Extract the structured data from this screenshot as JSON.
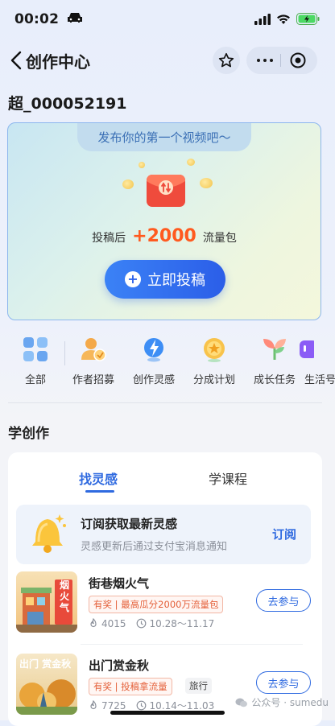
{
  "status_bar": {
    "time": "00:02"
  },
  "nav": {
    "title": "创作中心"
  },
  "account": {
    "name": "超_000052191"
  },
  "promo": {
    "tab_text": "发布你的第一个视频吧～",
    "reward_prefix": "投稿后",
    "reward_amount": "+2000",
    "reward_suffix": "流量包",
    "button_label": "立即投稿"
  },
  "shortcuts": [
    {
      "label": "全部",
      "icon": "grid-icon"
    },
    {
      "label": "作者招募",
      "icon": "recruit-icon"
    },
    {
      "label": "创作灵感",
      "icon": "lightning-icon"
    },
    {
      "label": "分成计划",
      "icon": "medal-icon"
    },
    {
      "label": "成长任务",
      "icon": "sprout-icon"
    },
    {
      "label": "生活号",
      "icon": "life-icon"
    }
  ],
  "learn": {
    "section_title": "学创作",
    "tabs": [
      "找灵感",
      "学课程"
    ],
    "subscribe": {
      "title": "订阅获取最新灵感",
      "desc": "灵感更新后通过支付宝消息通知",
      "button": "订阅"
    },
    "items": [
      {
        "title": "街巷烟火气",
        "tag": "有奖 | 最高瓜分2000万流量包",
        "views": "4015",
        "dates": "10.28～11.17",
        "join": "去参与",
        "thumb_text": "烟火气"
      },
      {
        "title": "出门赏金秋",
        "tag": "有奖 | 投稿拿流量",
        "tag2": "旅行",
        "views": "7725",
        "dates": "10.14～11.03",
        "join": "去参与",
        "thumb_text": "出门 赏金秋"
      }
    ]
  },
  "watermark": {
    "text": "公众号 · sumedu"
  },
  "colors": {
    "accent": "#2f6ae0",
    "reward": "#ff5a1f"
  }
}
